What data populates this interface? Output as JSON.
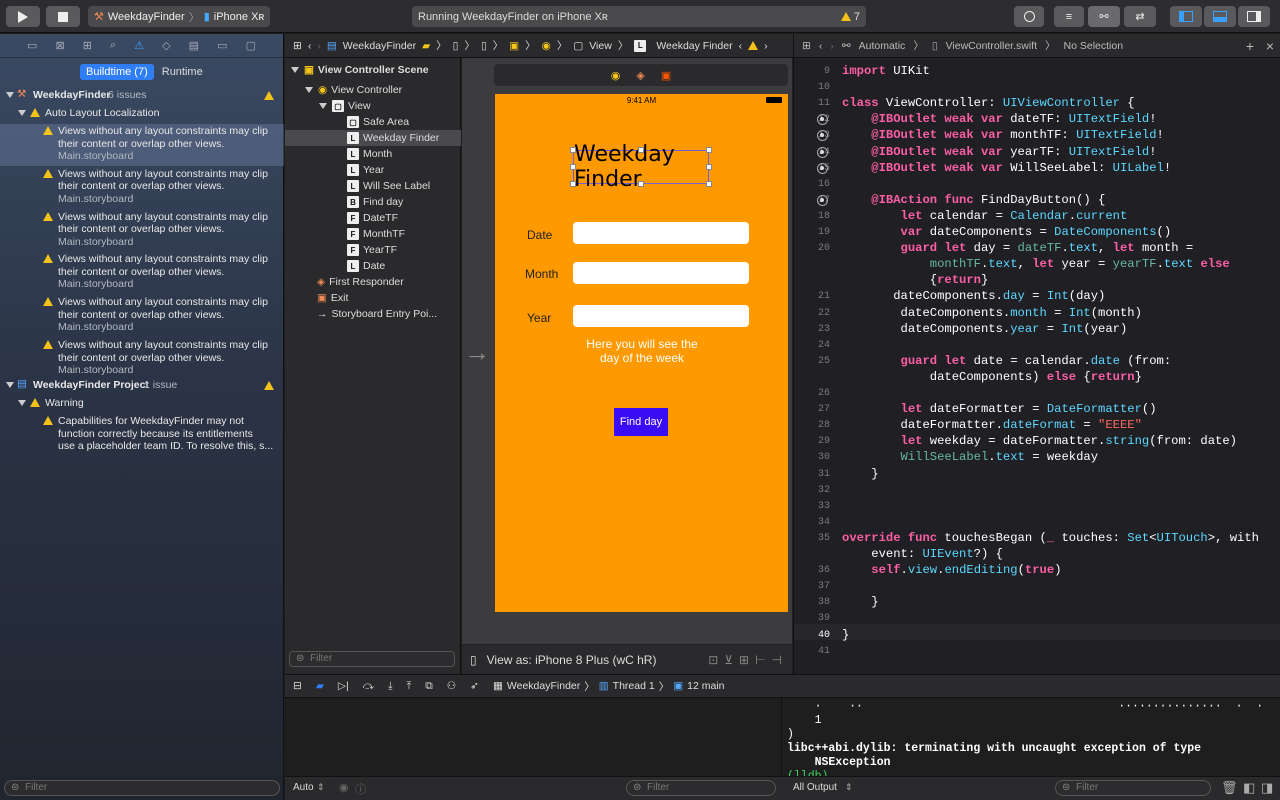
{
  "toolbar": {
    "scheme": "WeekdayFinder",
    "device": "iPhone Xʀ",
    "activity": "Running WeekdayFinder on iPhone Xʀ",
    "warn_count": "7"
  },
  "navigator": {
    "seg_build": "Buildtime (7)",
    "seg_run": "Runtime",
    "group1": {
      "title": "WeekdayFinder",
      "count": "6 issues",
      "sub": "Auto Layout Localization"
    },
    "issues": [
      {
        "l1": "Views without any layout constraints may clip",
        "l2": "their content or overlap other views.",
        "file": "Main.storyboard"
      },
      {
        "l1": "Views without any layout constraints may clip",
        "l2": "their content or overlap other views.",
        "file": "Main.storyboard"
      },
      {
        "l1": "Views without any layout constraints may clip",
        "l2": "their content or overlap other views.",
        "file": "Main.storyboard"
      },
      {
        "l1": "Views without any layout constraints may clip",
        "l2": "their content or overlap other views.",
        "file": "Main.storyboard"
      },
      {
        "l1": "Views without any layout constraints may clip",
        "l2": "their content or overlap other views.",
        "file": "Main.storyboard"
      },
      {
        "l1": "Views without any layout constraints may clip",
        "l2": "their content or overlap other views.",
        "file": "Main.storyboard"
      }
    ],
    "group2": {
      "title": "WeekdayFinder Project",
      "count": "1 issue",
      "sub": "Warning",
      "l1": "Capabilities for WeekdayFinder may not",
      "l2": "function correctly because its entitlements",
      "l3": "use a placeholder team ID. To resolve this, s..."
    },
    "filter": "Filter"
  },
  "outline": {
    "scene": "View Controller Scene",
    "vc": "View Controller",
    "view": "View",
    "items": [
      {
        "icon": "▢",
        "label": "Safe Area"
      },
      {
        "icon": "L",
        "label": "Weekday Finder"
      },
      {
        "icon": "L",
        "label": "Month"
      },
      {
        "icon": "L",
        "label": "Year"
      },
      {
        "icon": "L",
        "label": "Will See Label"
      },
      {
        "icon": "B",
        "label": "Find day"
      },
      {
        "icon": "F",
        "label": "DateTF"
      },
      {
        "icon": "F",
        "label": "MonthTF"
      },
      {
        "icon": "F",
        "label": "YearTF"
      },
      {
        "icon": "L",
        "label": "Date"
      }
    ],
    "first": "First Responder",
    "exit": "Exit",
    "entry": "Storyboard Entry Poi...",
    "filter": "Filter"
  },
  "jump": {
    "a": "WeekdayFinder",
    "b": "View",
    "c": "Weekday Finder"
  },
  "phone": {
    "time": "9:41 AM",
    "title": "Weekday Finder",
    "date": "Date",
    "month": "Month",
    "year": "Year",
    "info1": "Here you will see  the",
    "info2": "day of the week",
    "button": "Find day",
    "viewas": "View as: iPhone 8 Plus (wC hR)"
  },
  "editor": {
    "auto": "Automatic",
    "file": "ViewController.swift",
    "sel": "No Selection"
  },
  "debugbar": {
    "target": "WeekdayFinder",
    "thread": "Thread 1",
    "frame": "12 main"
  },
  "console": {
    "lines": [
      "    ·    ··                                     ···············  ·  ·",
      "    1",
      ")",
      "libc++abi.dylib: terminating with uncaught exception of type",
      "    NSException",
      "(lldb)"
    ]
  },
  "bottom": {
    "auto": "Auto",
    "filter1": "Filter",
    "output": "All Output",
    "filter2": "Filter"
  }
}
